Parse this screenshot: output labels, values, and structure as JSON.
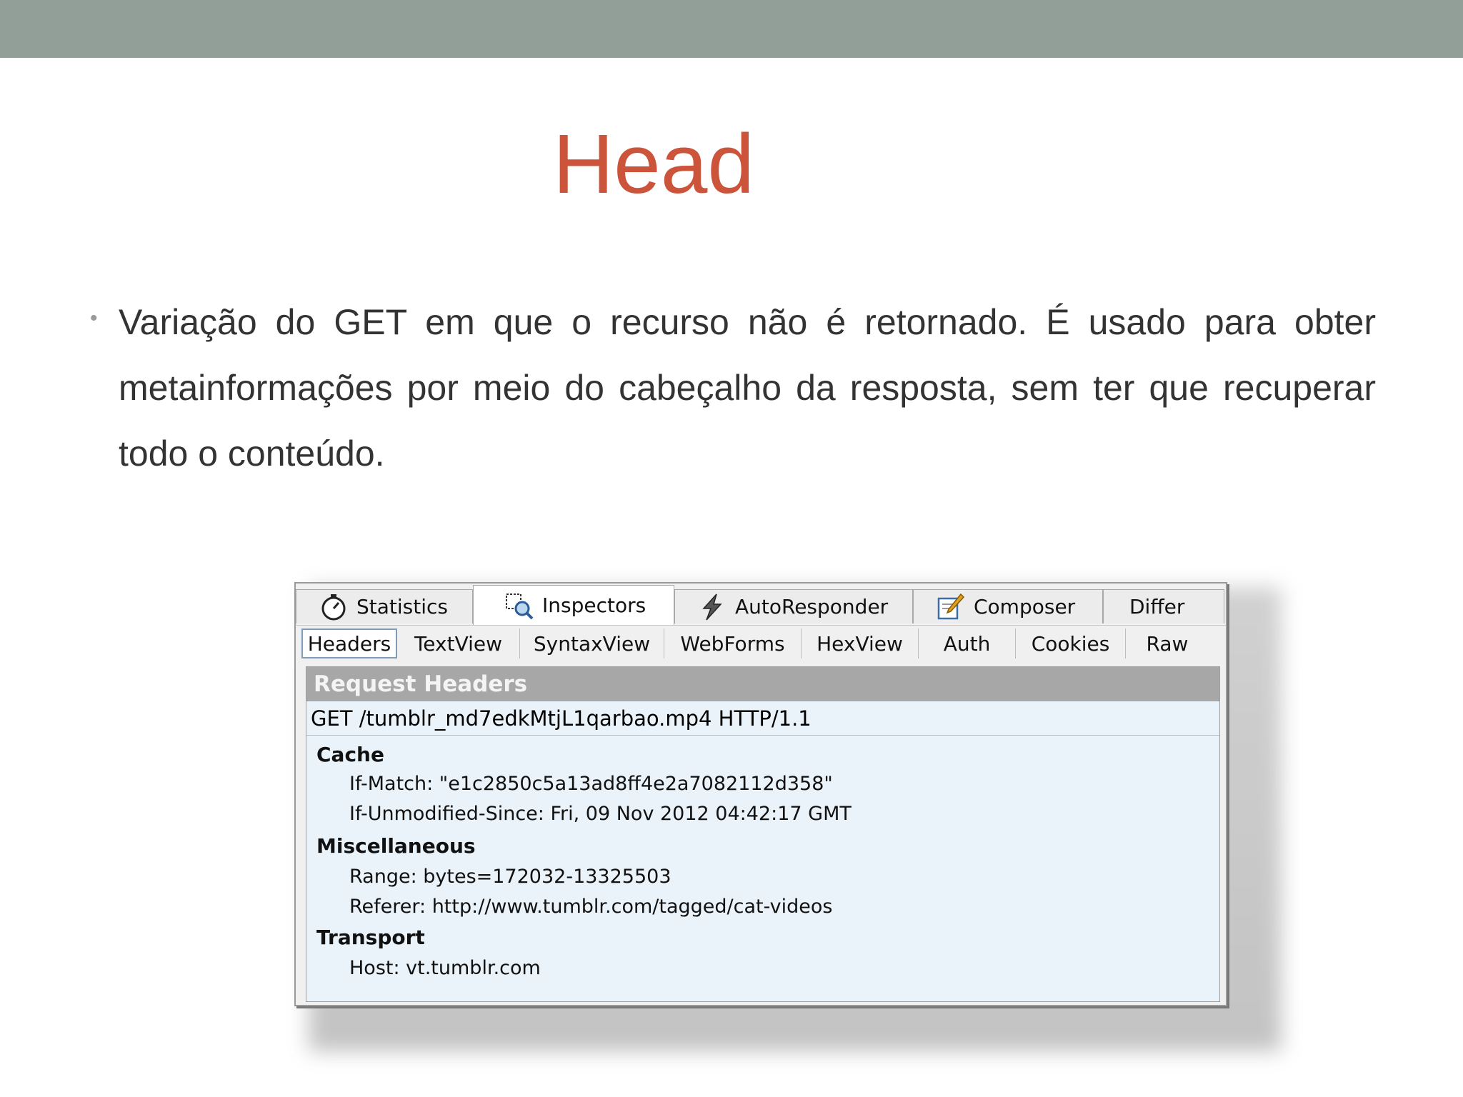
{
  "slide": {
    "title": "Head",
    "bullet": "Variação do GET em que o recurso não é retornado. É usado para obter metainformações por meio do cabeçalho da resposta, sem ter que recuperar todo o conteúdo."
  },
  "fiddler": {
    "tabs": [
      {
        "label": "Statistics",
        "icon": "stopwatch-icon"
      },
      {
        "label": "Inspectors",
        "icon": "inspector-icon"
      },
      {
        "label": "AutoResponder",
        "icon": "lightning-icon"
      },
      {
        "label": "Composer",
        "icon": "composer-icon"
      },
      {
        "label": "Differ"
      }
    ],
    "subtabs": [
      "Headers",
      "TextView",
      "SyntaxView",
      "WebForms",
      "HexView",
      "Auth",
      "Cookies",
      "Raw"
    ],
    "panel_title": "Request Headers",
    "request_line": "GET /tumblr_md7edkMtjL1qarbao.mp4 HTTP/1.1",
    "sections": [
      {
        "name": "Cache",
        "rows": [
          "If-Match: \"e1c2850c5a13ad8ff4e2a7082112d358\"",
          "If-Unmodified-Since: Fri, 09 Nov 2012 04:42:17 GMT"
        ]
      },
      {
        "name": "Miscellaneous",
        "rows": [
          "Range: bytes=172032-13325503",
          "Referer: http://www.tumblr.com/tagged/cat-videos"
        ]
      },
      {
        "name": "Transport",
        "rows": [
          "Host: vt.tumblr.com"
        ]
      }
    ]
  }
}
